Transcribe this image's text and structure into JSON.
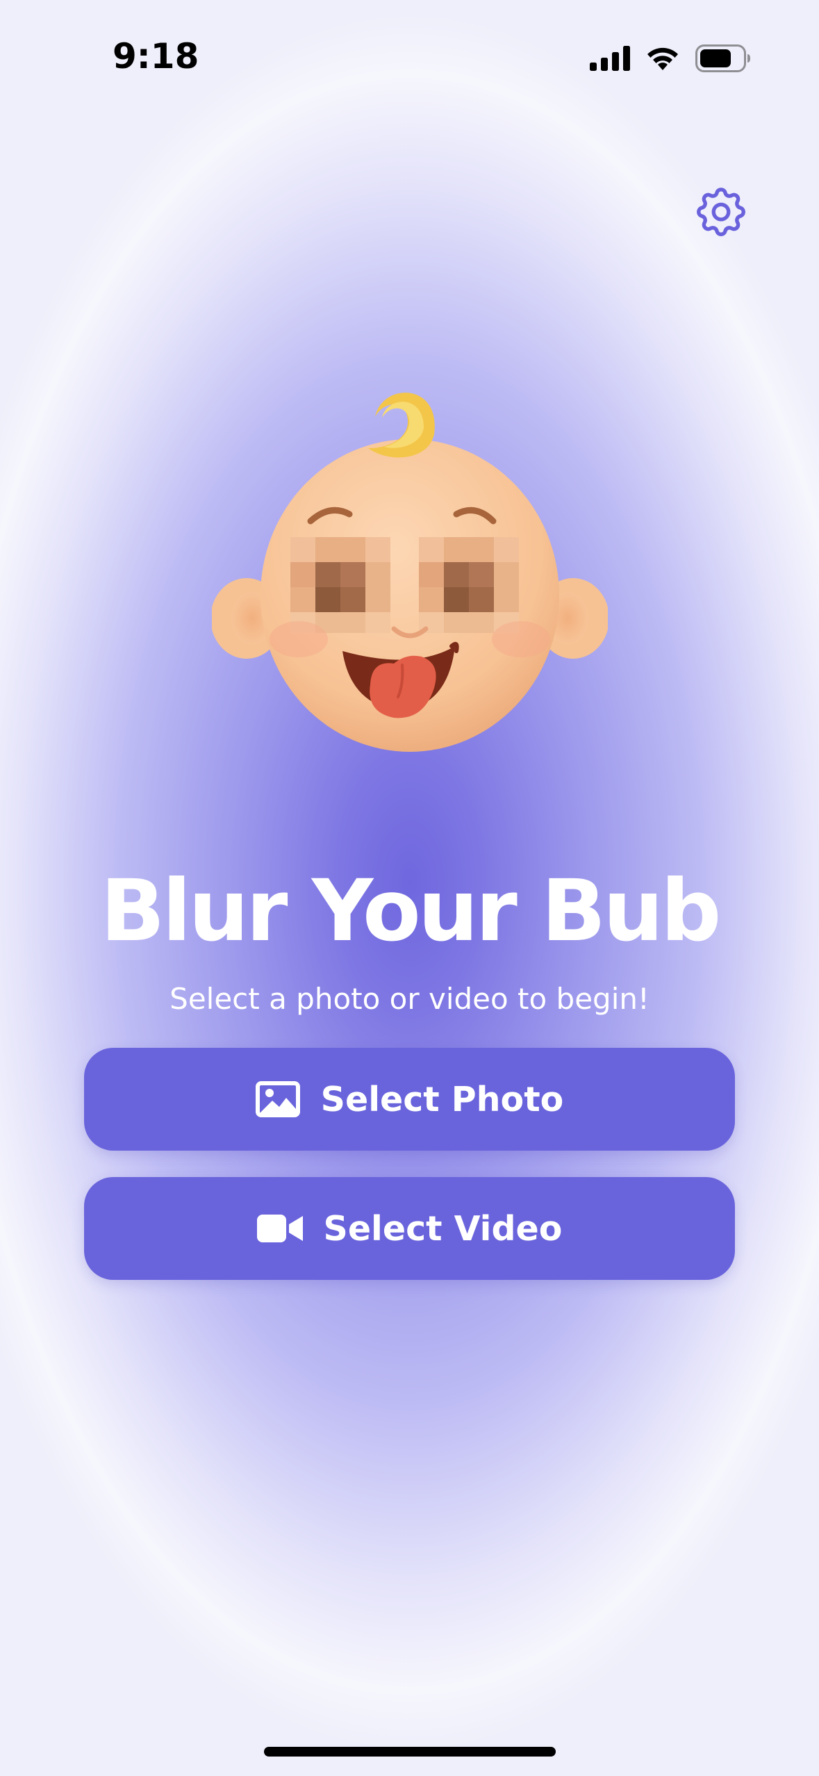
{
  "status_bar": {
    "time": "9:18",
    "icons": [
      "cellular-signal-icon",
      "wifi-icon",
      "battery-icon"
    ]
  },
  "header": {
    "settings_icon": "gear-icon"
  },
  "hero": {
    "image": "baby-face-pixelated-eyes"
  },
  "title": "Blur Your Bub",
  "subtitle": "Select a photo or video to begin!",
  "buttons": {
    "photo": {
      "label": "Select Photo",
      "icon": "photo-icon"
    },
    "video": {
      "label": "Select Video",
      "icon": "video-camera-icon"
    }
  },
  "colors": {
    "accent": "#6964dc",
    "settings_icon": "#6a62dc",
    "title_text": "#ffffff"
  }
}
